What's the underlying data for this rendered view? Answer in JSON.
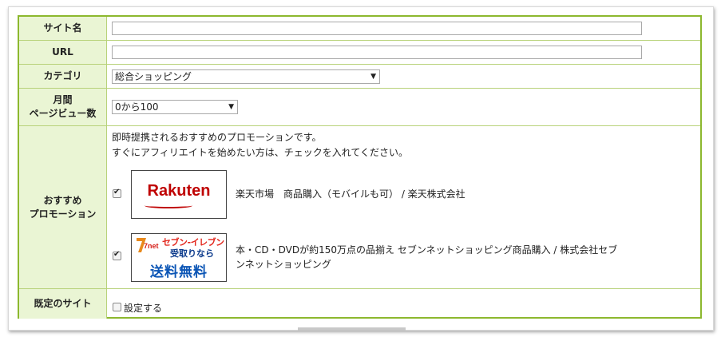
{
  "form": {
    "site_name": {
      "label": "サイト名",
      "value": ""
    },
    "url": {
      "label": "URL",
      "value": ""
    },
    "category": {
      "label": "カテゴリ",
      "selected": "総合ショッピング"
    },
    "monthly_pv": {
      "label_line1": "月間",
      "label_line2": "ページビュー数",
      "selected": "0から100"
    },
    "promotion": {
      "label_line1": "おすすめ",
      "label_line2": "プロモーション",
      "intro_line1": "即時提携されるおすすめのプロモーションです。",
      "intro_line2": "すぐにアフィリエイトを始めたい方は、チェックを入れてください。",
      "items": [
        {
          "checked": true,
          "banner_text": "Rakuten",
          "description": "楽天市場　商品購入（モバイルも可） / 楽天株式会社"
        },
        {
          "checked": true,
          "banner_text_1": "セブン-イレブン",
          "banner_text_2": "受取りなら",
          "banner_text_3": "送料無料",
          "logo_text": "7net",
          "description_line1": "本・CD・DVDが約150万点の品揃え セブンネットショッピング商品購入 / 株式会社セブ",
          "description_line2": "ンネットショッピング"
        }
      ]
    },
    "default_site": {
      "label": "既定のサイト",
      "checkbox_label": "設定する",
      "checked": false
    }
  },
  "colors": {
    "border_green": "#8cb82e",
    "label_bg": "#eaf5d4",
    "rakuten_red": "#bf0000",
    "seven_red": "#e2261c",
    "seven_blue": "#0b55b5"
  }
}
